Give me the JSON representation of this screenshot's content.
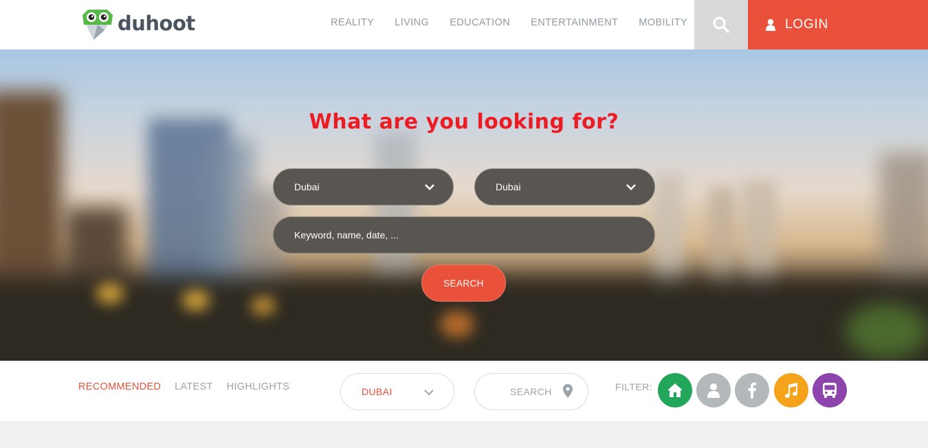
{
  "brand": {
    "name": "duhoot"
  },
  "nav": {
    "items": [
      "REALITY",
      "LIVING",
      "EDUCATION",
      "ENTERTAINMENT",
      "MOBILITY"
    ],
    "search_icon": "search-icon",
    "login_label": "LOGIN",
    "login_icon": "user-icon"
  },
  "hero": {
    "title": "What are you looking for?",
    "select_one": "Dubai",
    "select_two": "Dubai",
    "keyword_placeholder": "Keyword, name, date, ...",
    "search_label": "SEARCH"
  },
  "filter_bar": {
    "tabs": [
      "RECOMMENDED",
      "LATEST",
      "HIGHLIGHTS"
    ],
    "active_tab": "RECOMMENDED",
    "city": "DUBAI",
    "search_label": "SEARCH",
    "filter_label": "FILTER:",
    "filters": [
      {
        "icon": "home-icon",
        "color": "#21a65a"
      },
      {
        "icon": "person-icon",
        "color": "#b3b8bb"
      },
      {
        "icon": "facebook-icon",
        "color": "#b3b8bb"
      },
      {
        "icon": "music-icon",
        "color": "#f5a31a"
      },
      {
        "icon": "bus-icon",
        "color": "#8e44ad"
      }
    ]
  },
  "colors": {
    "accent": "#e9513a",
    "title_red": "#ec1c24",
    "pill_bg": "#595551",
    "nav_text": "#8f9aa2"
  }
}
